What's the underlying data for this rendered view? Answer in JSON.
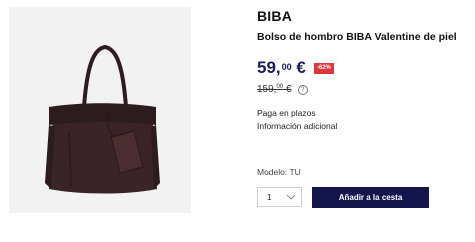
{
  "product": {
    "brand": "BIBA",
    "title": "Bolso de hombro BIBA Valentine de piel",
    "price": {
      "integer": "59,",
      "decimals": "00",
      "currency": "€"
    },
    "discount_badge": "-62%",
    "old_price": {
      "integer": "159,",
      "decimals": "00",
      "currency": "€"
    },
    "payment_link": "Paga en plazos",
    "info_link": "Información adicional",
    "model_label": "Modelo: TU",
    "quantity": "1",
    "add_to_cart": "Añadir a la cesta"
  },
  "icons": {
    "info": "info-circle-icon",
    "dropdown": "chevron-down-icon"
  },
  "colors": {
    "price": "#1b1d5c",
    "discount": "#e0343c",
    "button": "#14154c",
    "bag": "#3a2427"
  }
}
